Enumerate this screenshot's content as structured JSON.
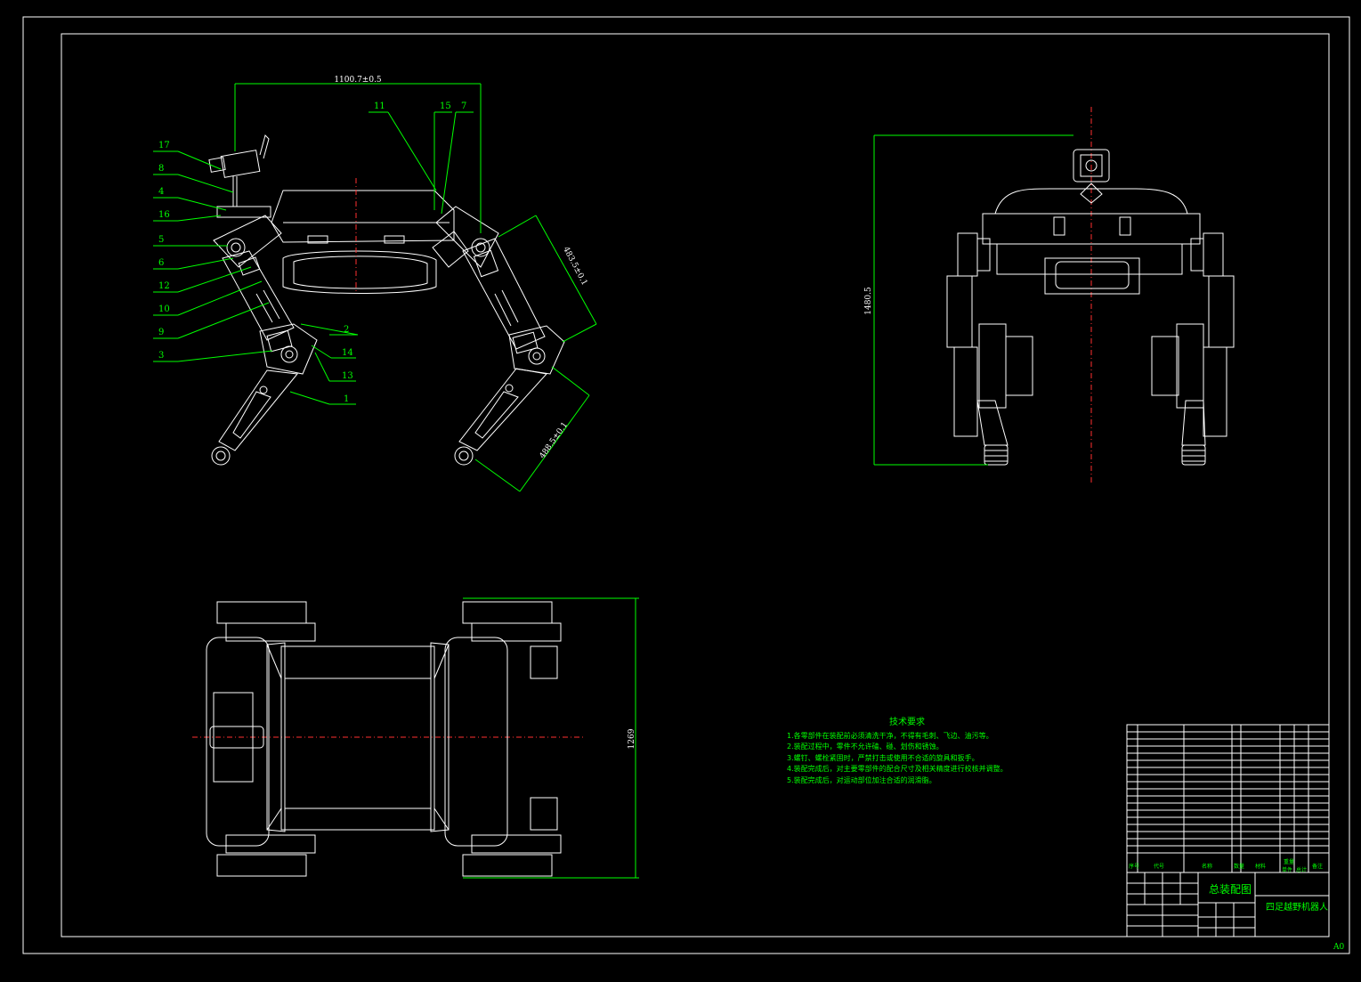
{
  "dimensions": {
    "top_width": "1100.7±0.5",
    "height_side": "1480.5",
    "thigh": "483.5±0.1",
    "shin": "488.5±0.1",
    "plan_width": "1269"
  },
  "callouts": [
    "17",
    "8",
    "4",
    "16",
    "5",
    "6",
    "12",
    "10",
    "9",
    "3",
    "11",
    "15",
    "7",
    "2",
    "14",
    "13",
    "1"
  ],
  "tech_requirements": {
    "title": "技术要求",
    "items": [
      "1.各零部件在装配前必须清洗干净，不得有毛刺、飞边、油污等。",
      "2.装配过程中，零件不允许磕、碰、划伤和锈蚀。",
      "3.螺钉、螺栓紧固时，严禁打击或使用不合适的旋具和扳手。",
      "4.装配完成后，对主要零部件的配合尺寸及相关精度进行校核并调整。",
      "5.装配完成后，对运动部位加注合适的润滑脂。"
    ]
  },
  "title_block": {
    "drawing_title": "总装配图",
    "product_name": "四足越野机器人",
    "sheet_size": "A0",
    "header": [
      "序号",
      "代号",
      "名称",
      "数量",
      "材料",
      "单件",
      "总计",
      "备注"
    ],
    "header_weight": "重量"
  }
}
